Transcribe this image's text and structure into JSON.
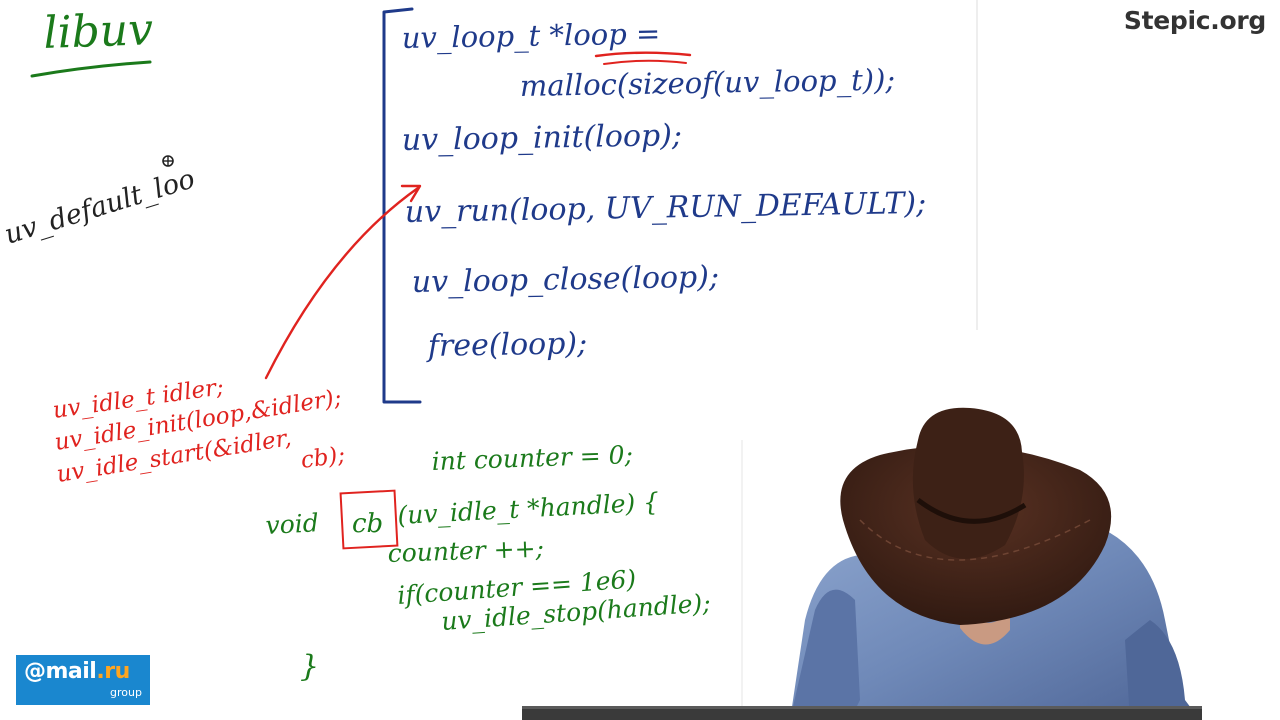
{
  "watermark": {
    "site": "Stepic.org"
  },
  "logo": {
    "at_sign": "@",
    "mail": "mail",
    "dot_ru": ".ru",
    "group": "group"
  },
  "heading": {
    "libuv": "libuv",
    "default_loop": "uv_default_loo"
  },
  "blue_code": [
    "uv_loop_t  *loop =",
    "malloc(sizeof(uv_loop_t));",
    "uv_loop_init(loop);",
    "uv_run(loop, UV_RUN_DEFAULT);",
    "uv_loop_close(loop);",
    "free(loop);"
  ],
  "red_code": [
    "uv_idle_t idler;",
    "uv_idle_init(loop,&idler);",
    "uv_idle_start(&idler,",
    "cb);"
  ],
  "green_code": {
    "counter_decl": "int counter = 0;",
    "void_kw": "void",
    "cb_name": "cb",
    "signature_rest": "(uv_idle_t  *handle) {",
    "increment": "counter ++;",
    "condition": "if(counter == 1e6)",
    "stop_call": "uv_idle_stop(handle);",
    "close_brace": "}"
  },
  "colors": {
    "blue_ink": "#1f3a8a",
    "red_ink": "#e0231f",
    "green_ink": "#1b7a1b",
    "brand_blue": "#1a87cf",
    "brand_orange": "#ffa51f"
  }
}
